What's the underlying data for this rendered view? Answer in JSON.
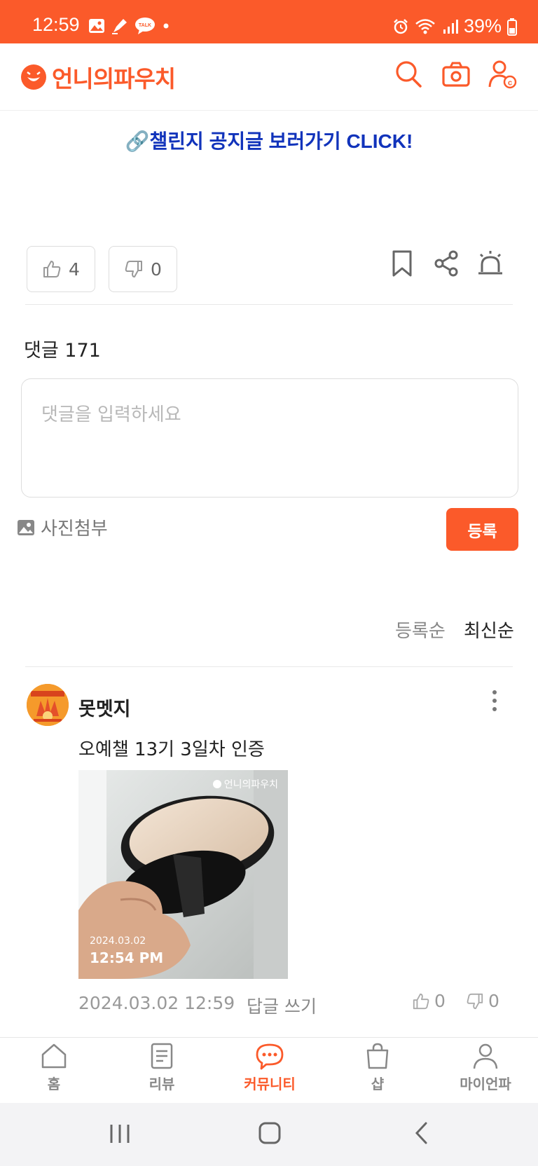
{
  "status_bar": {
    "time": "12:59",
    "battery": "39%",
    "icons": [
      "gallery-icon",
      "pen-icon",
      "talk-icon",
      "dot-icon",
      "alarm-icon",
      "wifi-icon",
      "signal-icon",
      "battery-icon"
    ],
    "talk_label": "TALK"
  },
  "header": {
    "logo_text": "언니의파우치",
    "icons": [
      "search-icon",
      "camera-icon",
      "user-coin-icon"
    ]
  },
  "post": {
    "challenge_link": "🔗챌린지 공지글 보러가기 CLICK!",
    "likes": "4",
    "dislikes": "0",
    "action_icons": [
      "bookmark-icon",
      "share-icon",
      "report-siren-icon"
    ]
  },
  "comments": {
    "title": "댓글 171",
    "input_placeholder": "댓글을 입력하세요",
    "attach_label": "사진첨부",
    "submit_label": "등록",
    "sort_old": "등록순",
    "sort_new": "최신순",
    "items": [
      {
        "username": "못멧지",
        "text": "오예챌 13기 3일차 인증",
        "image_watermark": "언니의파우치",
        "image_date": "2024.03.02",
        "image_time": "12:54 PM",
        "date": "2024.03.02 12:59",
        "reply_label": "답글 쓰기",
        "likes": "0",
        "dislikes": "0"
      }
    ]
  },
  "bottom_nav": {
    "items": [
      {
        "label": "홈",
        "icon": "home-icon"
      },
      {
        "label": "리뷰",
        "icon": "review-doc-icon"
      },
      {
        "label": "커뮤니티",
        "icon": "community-chat-icon",
        "active": true
      },
      {
        "label": "샵",
        "icon": "shopping-bag-icon"
      },
      {
        "label": "마이언파",
        "icon": "profile-icon"
      }
    ]
  },
  "colors": {
    "brand": "#fb5a2a",
    "link": "#1133bb"
  }
}
